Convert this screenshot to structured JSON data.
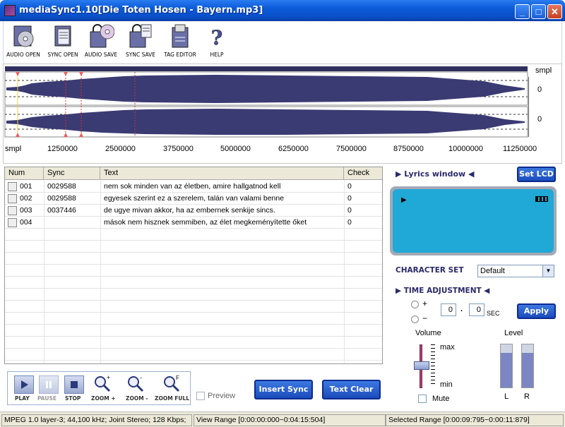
{
  "window": {
    "title": "mediaSync1.10[Die Toten Hosen - Bayern.mp3]"
  },
  "toolbar": {
    "items": [
      {
        "label": "AUDIO OPEN",
        "icon": "audio-open-icon"
      },
      {
        "label": "SYNC OPEN",
        "icon": "sync-open-icon"
      },
      {
        "label": "AUDIO SAVE",
        "icon": "audio-save-icon"
      },
      {
        "label": "SYNC SAVE",
        "icon": "sync-save-icon"
      },
      {
        "label": "TAG EDITOR",
        "icon": "tag-editor-icon"
      },
      {
        "label": "HELP",
        "icon": "help-icon"
      }
    ]
  },
  "waveform": {
    "unit_label": "smpl",
    "channel_zero": "0",
    "x_axis": [
      "1250000",
      "2500000",
      "3750000",
      "5000000",
      "6250000",
      "7500000",
      "8750000",
      "10000000",
      "11250000"
    ],
    "colors": {
      "wave": "#3b3b73",
      "marker": "#ff3333"
    }
  },
  "lyrics_table": {
    "columns": [
      "Num",
      "Sync",
      "Text",
      "Check"
    ],
    "rows": [
      {
        "num": "001",
        "sync": "0029588",
        "text": "nem sok minden van az életben, amire hallgatnod kell",
        "check": "0"
      },
      {
        "num": "002",
        "sync": "0029588",
        "text": "egyesek szerint ez a szerelem, talán van valami benne",
        "check": "0"
      },
      {
        "num": "003",
        "sync": "0037446",
        "text": "de ugye mivan akkor, ha az embernek senkije sincs.",
        "check": "0"
      },
      {
        "num": "004",
        "sync": "",
        "text": "mások nem hisznek semmiben, az élet megkeményítette őket",
        "check": "0"
      }
    ]
  },
  "right_panel": {
    "lyrics_window_label": "Lyrics window",
    "set_lcd_label": "Set LCD",
    "character_set_label": "CHARACTER SET",
    "character_set_value": "Default",
    "time_adjustment_label": "TIME ADJUSTMENT",
    "plus": "+",
    "minus": "−",
    "sec_value": "0",
    "frac_value": "0",
    "dot": ".",
    "sec_label": "SEC",
    "apply_label": "Apply",
    "volume_label": "Volume",
    "max_label": "max",
    "min_label": "min",
    "mute_label": "Mute",
    "level_label": "Level",
    "left_label": "L",
    "right_label": "R",
    "lcd_color": "#20a8d6"
  },
  "transport": {
    "play": "PLAY",
    "pause": "PAUSE",
    "stop": "STOP",
    "zoom_in": "ZOOM +",
    "zoom_out": "ZOOM -",
    "zoom_full": "ZOOM FULL",
    "preview_label": "Preview",
    "insert_sync_label": "Insert Sync",
    "text_clear_label": "Text Clear"
  },
  "status": {
    "format": "MPEG 1.0 layer-3; 44,100 kHz; Joint Stereo; 128 Kbps;",
    "view_range": "View Range [0:00:00:000~0:04:15:504]",
    "selected_range": "Selected Range [0:00:09:795~0:00:11:879]"
  }
}
